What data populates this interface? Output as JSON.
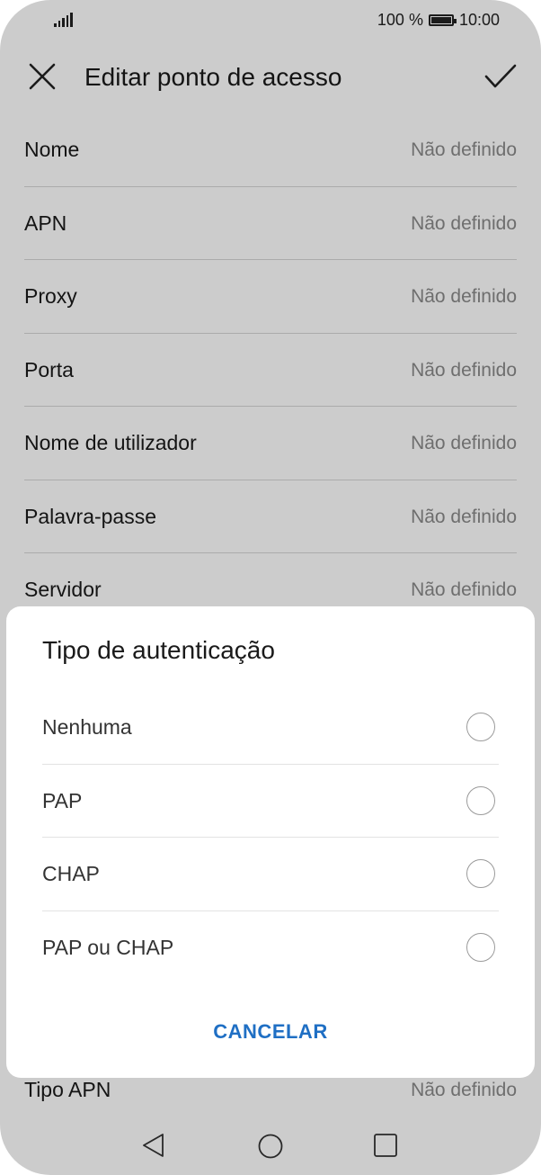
{
  "status_bar": {
    "battery_text": "100 %",
    "time": "10:00"
  },
  "appbar": {
    "title": "Editar ponto de acesso",
    "close_icon": "close-icon",
    "confirm_icon": "check-icon"
  },
  "fields": [
    {
      "label": "Nome",
      "value": "Não definido"
    },
    {
      "label": "APN",
      "value": "Não definido"
    },
    {
      "label": "Proxy",
      "value": "Não definido"
    },
    {
      "label": "Porta",
      "value": "Não definido"
    },
    {
      "label": "Nome de utilizador",
      "value": "Não definido"
    },
    {
      "label": "Palavra-passe",
      "value": "Não definido"
    },
    {
      "label": "Servidor",
      "value": "Não definido"
    }
  ],
  "bottom_field": {
    "label": "Tipo APN",
    "value": "Não definido"
  },
  "dialog": {
    "title": "Tipo de autenticação",
    "options": [
      "Nenhuma",
      "PAP",
      "CHAP",
      "PAP ou CHAP"
    ],
    "cancel_label": "CANCELAR"
  },
  "colors": {
    "accent": "#1f6fc4",
    "scrim": "rgba(0,0,0,0.2)"
  }
}
